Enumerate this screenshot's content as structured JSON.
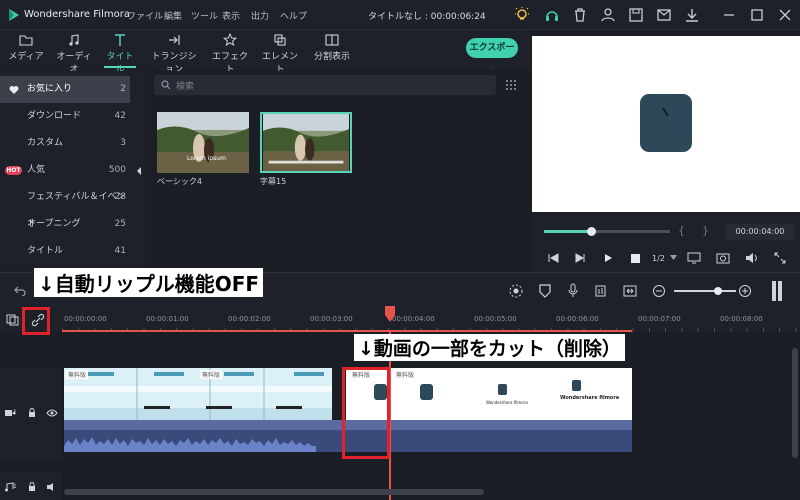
{
  "titlebar": {
    "app_name": "Wondershare Filmora",
    "menu": [
      "ファイル",
      "編集",
      "ツール",
      "表示",
      "出力",
      "ヘルプ"
    ],
    "doc_title": "タイトルなし : 00:00:06:24"
  },
  "toolbar": {
    "tabs": [
      {
        "label": "メディア",
        "icon": "folder-icon"
      },
      {
        "label": "オーディオ",
        "icon": "music-note-icon"
      },
      {
        "label": "タイトル",
        "icon": "text-t-icon"
      },
      {
        "label": "トランジション",
        "icon": "transition-icon"
      },
      {
        "label": "エフェクト",
        "icon": "effects-icon"
      },
      {
        "label": "エレメント",
        "icon": "elements-icon"
      },
      {
        "label": "分割表示",
        "icon": "split-screen-icon"
      }
    ],
    "active_tab": "タイトル",
    "export_label": "エクスポート"
  },
  "sidebar": {
    "items": [
      {
        "label": "お気に入り",
        "count": "2"
      },
      {
        "label": "ダウンロード",
        "count": "42"
      },
      {
        "label": "カスタム",
        "count": "3"
      },
      {
        "label": "人気",
        "count": "500",
        "badge": "HOT"
      },
      {
        "label": "フェスティバル＆イベント",
        "count": "28"
      },
      {
        "label": "オープニング",
        "count": "25"
      },
      {
        "label": "タイトル",
        "count": "41"
      }
    ]
  },
  "library": {
    "search_placeholder": "検索",
    "items": [
      {
        "label": "ベーシック4",
        "overlay_text": "Lorem ipsum"
      },
      {
        "label": "字幕15"
      }
    ]
  },
  "preview": {
    "timecode": "00:00:04:00",
    "speed": "1/2",
    "progress": 0.37
  },
  "timeline": {
    "ruler_ticks": [
      "00:00:00:00",
      "00:00:01:00",
      "00:00:02:00",
      "00:00:03:00",
      "00:00:04:00",
      "00:00:05:00",
      "00:00:06:00",
      "00:00:07:00",
      "00:00:08:00"
    ],
    "clip_watermark": "無料版",
    "clip_brand": "Wondershare filmora",
    "track_video": "1",
    "track_audio": "1"
  },
  "annotations": {
    "ripple": "↓自動リップル機能OFF",
    "cut": "↓動画の一部をカット（削除）"
  },
  "colors": {
    "accent": "#3fd1b0",
    "annotation_red": "#e0232a",
    "playhead": "#e8534c",
    "audio_wave": "#5a6fb2",
    "clip_bar": "#3a4a7a"
  }
}
